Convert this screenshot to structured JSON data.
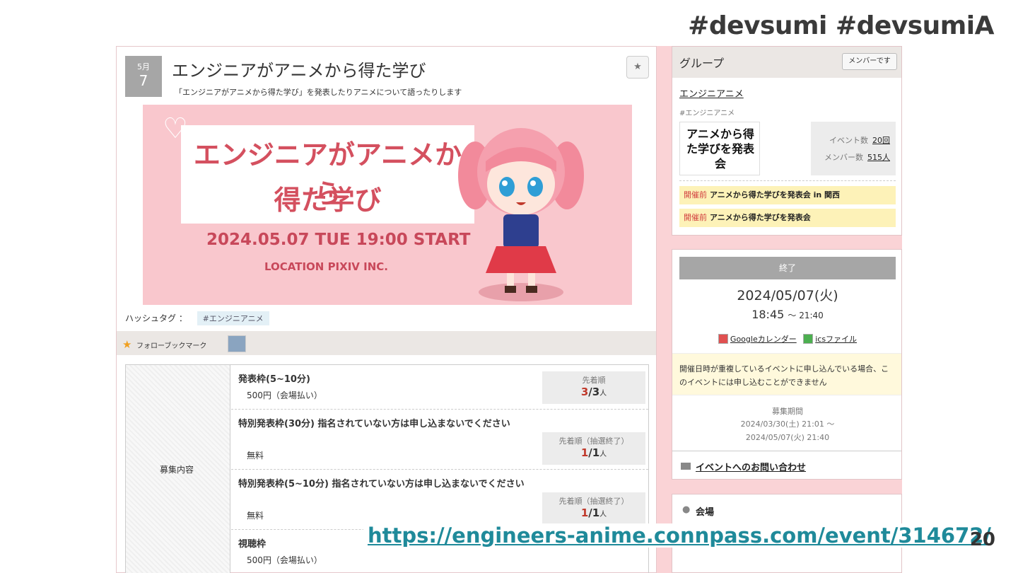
{
  "slide": {
    "hashtags": "#devsumi #devsumiA",
    "link": "https://engineers-anime.connpass.com/event/314672/",
    "page_number": "20"
  },
  "event": {
    "month": "5月",
    "day": "7",
    "title": "エンジニアがアニメから得た学び",
    "subtitle": "「エンジニアがアニメから得た学び」を発表したりアニメについて語ったりします",
    "bookmark_icon": "star-icon"
  },
  "banner": {
    "line1": "エンジニアがアニメから",
    "line2": "得た学び",
    "date": "2024.05.07 TUE 19:00 START",
    "location": "LOCATION PIXIV INC."
  },
  "hashtag": {
    "label": "ハッシュタグ ：",
    "tag": "#エンジニアニメ"
  },
  "follow": {
    "label": "フォローブックマーク"
  },
  "recruit": {
    "header": "募集内容",
    "rows": [
      {
        "name": "発表枠(5~10分)",
        "price": "500円（会場払い）",
        "type": "先着順",
        "filled": "3",
        "sep": "/",
        "capacity": "3",
        "unit": "人"
      },
      {
        "name": "特別発表枠(30分) 指名されていない方は申し込まないでください",
        "price": "無料",
        "type": "先着順（抽選終了）",
        "filled": "1",
        "sep": "/",
        "capacity": "1",
        "unit": "人"
      },
      {
        "name": "特別発表枠(5~10分) 指名されていない方は申し込まないでください",
        "price": "無料",
        "type": "先着順（抽選終了）",
        "filled": "1",
        "sep": "/",
        "capacity": "1",
        "unit": "人"
      },
      {
        "name": "視聴枠",
        "price": "500円（会場払い）"
      }
    ]
  },
  "group": {
    "header": "グループ",
    "member_button": "メンバーです",
    "name": "エンジニアニメ",
    "tag": "#エンジニアニメ",
    "logo_text": "アニメから得た学びを発表会",
    "stats": {
      "event_label": "イベント数",
      "event_count": "20回",
      "member_label": "メンバー数",
      "member_count": "515人"
    },
    "events": [
      {
        "status": "開催前",
        "title": "アニメから得た学びを発表会 in 関西"
      },
      {
        "status": "開催前",
        "title": "アニメから得た学びを発表会"
      }
    ]
  },
  "schedule": {
    "status": "終了",
    "date": "2024/05/07(火)",
    "start": "18:45",
    "end": "～ 21:40",
    "google_cal": "Googleカレンダー",
    "ics": "icsファイル",
    "warning": "開催日時が重複しているイベントに申し込んでいる場合、このイベントには申し込むことができません",
    "period_label": "募集期間",
    "period_start": "2024/03/30(土) 21:01 ～",
    "period_end": "2024/05/07(火) 21:40",
    "contact": "イベントへのお問い合わせ"
  },
  "venue": {
    "label": "会場"
  },
  "colors": {
    "accent": "#d4505f",
    "link": "#1f8a9a",
    "pink_bg": "#fad3d6"
  }
}
